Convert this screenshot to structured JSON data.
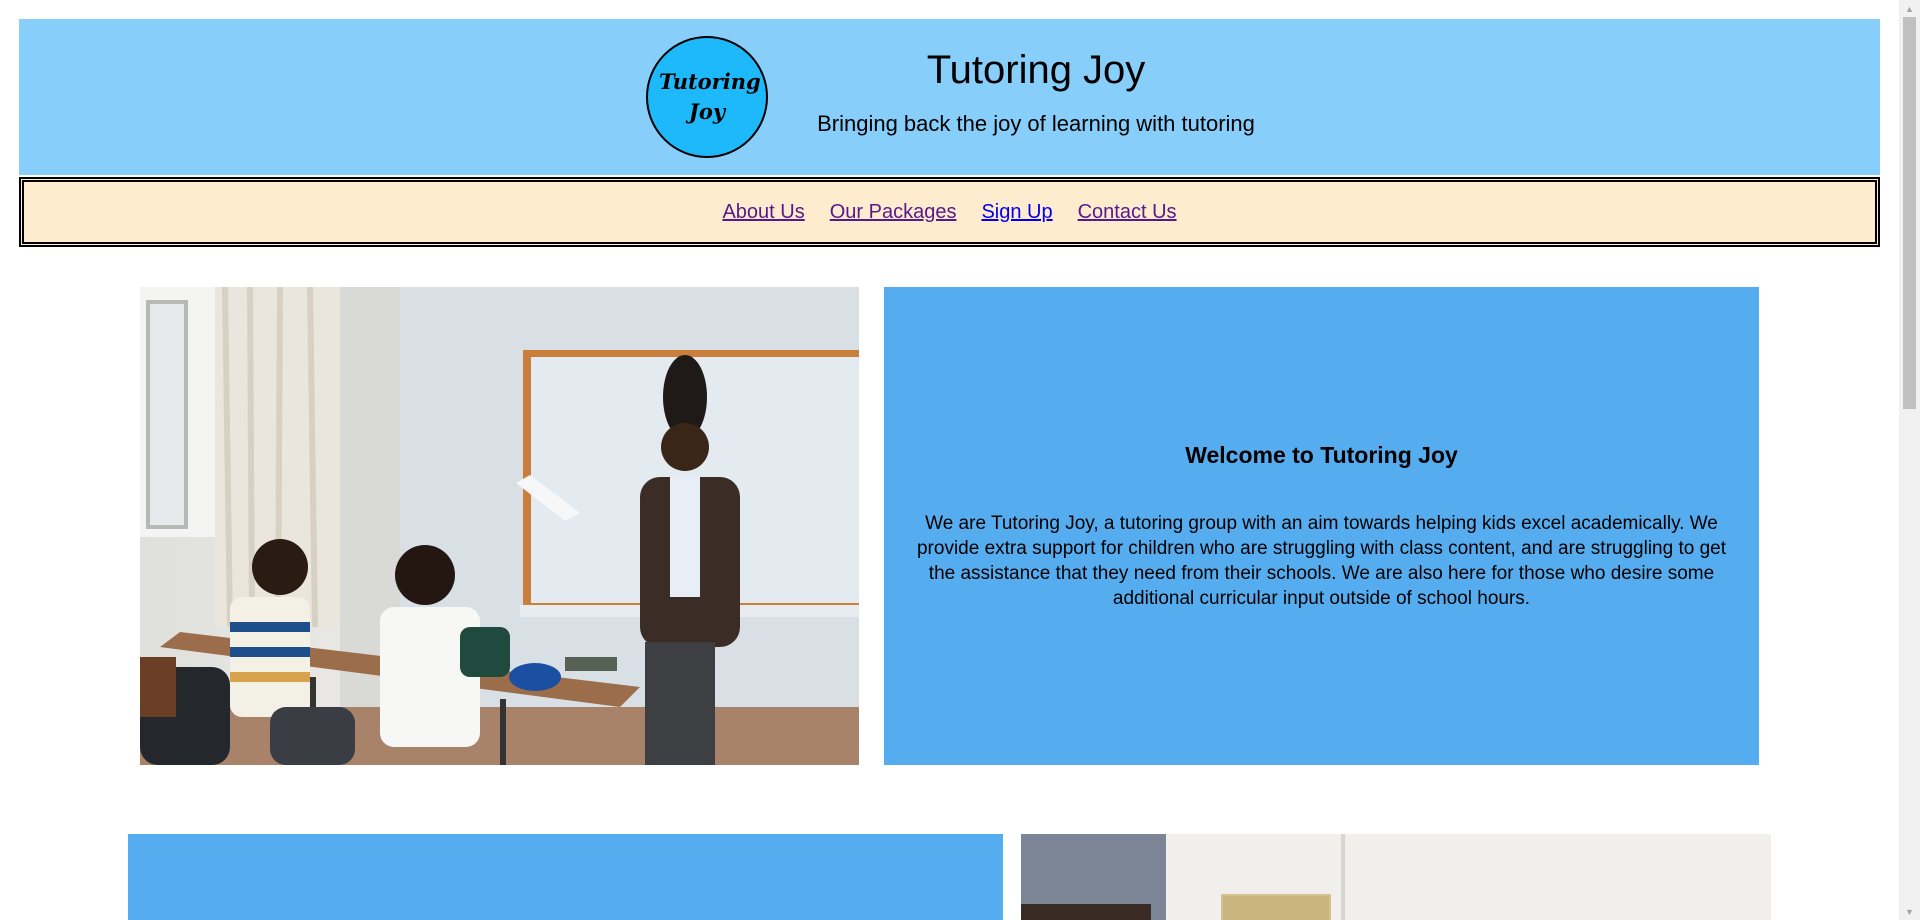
{
  "header": {
    "logo_text": "Tutoring Joy",
    "title": "Tutoring Joy",
    "tagline": "Bringing back the joy of learning with tutoring"
  },
  "nav": {
    "items": [
      {
        "label": "About Us"
      },
      {
        "label": "Our Packages"
      },
      {
        "label": "Sign Up"
      },
      {
        "label": "Contact Us"
      }
    ]
  },
  "welcome": {
    "heading": "Welcome to Tutoring Joy",
    "body": "We are Tutoring Joy, a tutoring group with an aim towards helping kids excel academically. We provide extra support for children who are struggling with class content, and are struggling to get the assistance that they need from their schools. We are also here for those who desire some additional curricular input outside of school hours."
  },
  "colors": {
    "header_bg": "#87cefa",
    "logo_bg": "#1eb9fb",
    "nav_bg": "#ffebcd",
    "panel_bg": "#55acee",
    "link_visited": "#551a8b",
    "link_unvisited": "#0000ee"
  }
}
